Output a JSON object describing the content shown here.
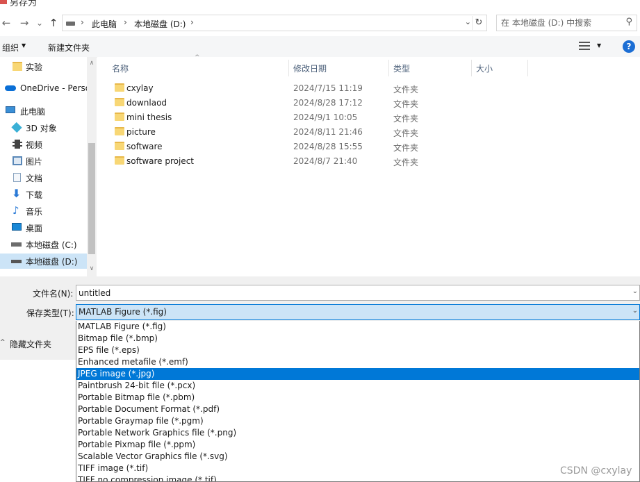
{
  "window": {
    "title": "另存为"
  },
  "nav": {
    "back_glyph": "←",
    "forward_glyph": "→",
    "recent_glyph": "⌄",
    "up_glyph": "↑",
    "breadcrumb": [
      "此电脑",
      "本地磁盘 (D:)"
    ],
    "breadcrumb_sep": "›",
    "dropdown_glyph": "⌄",
    "refresh_glyph": "↻",
    "search_placeholder": "在 本地磁盘 (D:) 中搜索",
    "search_icon_glyph": "⚲"
  },
  "toolbar": {
    "organize_label": "组织",
    "organize_caret": "▼",
    "new_folder_label": "新建文件夹",
    "view_caret": "▼",
    "help_glyph": "?"
  },
  "sidebar": {
    "up_arrow": "∧",
    "down_arrow": "∨",
    "items": [
      {
        "label": "实验",
        "icon": "folder-icon",
        "color": "#f8d775"
      },
      {
        "label": "OneDrive - Personal",
        "icon": "cloud-icon",
        "color": "#0a6fd6"
      },
      {
        "label": "此电脑",
        "icon": "computer-icon",
        "color": "#3a8fd6"
      },
      {
        "label": "3D 对象",
        "icon": "cube-icon",
        "color": "#3ab0d6"
      },
      {
        "label": "视频",
        "icon": "video-icon",
        "color": "#444444"
      },
      {
        "label": "图片",
        "icon": "picture-icon",
        "color": "#5a88b8"
      },
      {
        "label": "文档",
        "icon": "document-icon",
        "color": "#8aa4c0"
      },
      {
        "label": "下载",
        "icon": "download-icon",
        "color": "#2a7ad6"
      },
      {
        "label": "音乐",
        "icon": "music-icon",
        "color": "#2a7ad6"
      },
      {
        "label": "桌面",
        "icon": "desktop-icon",
        "color": "#1a88d6"
      },
      {
        "label": "本地磁盘 (C:)",
        "icon": "windows-drive-icon",
        "color": "#555555"
      },
      {
        "label": "本地磁盘 (D:)",
        "icon": "drive-icon",
        "color": "#555555",
        "selected": true
      }
    ]
  },
  "columns": {
    "name": "名称",
    "modified": "修改日期",
    "type": "类型",
    "size": "大小",
    "sort_glyph": "^"
  },
  "files": [
    {
      "name": "cxylay",
      "modified": "2024/7/15 11:19",
      "type": "文件夹"
    },
    {
      "name": "downlaod",
      "modified": "2024/8/28 17:12",
      "type": "文件夹"
    },
    {
      "name": "mini thesis",
      "modified": "2024/9/1 10:05",
      "type": "文件夹"
    },
    {
      "name": "picture",
      "modified": "2024/8/11 21:46",
      "type": "文件夹"
    },
    {
      "name": "software",
      "modified": "2024/8/28 15:55",
      "type": "文件夹"
    },
    {
      "name": "software project",
      "modified": "2024/8/7 21:40",
      "type": "文件夹"
    }
  ],
  "form": {
    "filename_label": "文件名(N):",
    "filename_value": "untitled",
    "filetype_label": "保存类型(T):",
    "filetype_value": "MATLAB Figure (*.fig)",
    "dropdown_glyph": "⌄",
    "hide_folders_label": "隐藏文件夹",
    "hide_folders_caret": "^"
  },
  "type_options": [
    {
      "label": "MATLAB Figure (*.fig)"
    },
    {
      "label": "Bitmap file (*.bmp)"
    },
    {
      "label": "EPS file (*.eps)"
    },
    {
      "label": "Enhanced metafile (*.emf)"
    },
    {
      "label": "JPEG image (*.jpg)",
      "selected": true
    },
    {
      "label": "Paintbrush 24-bit file (*.pcx)"
    },
    {
      "label": "Portable Bitmap file (*.pbm)"
    },
    {
      "label": "Portable Document Format (*.pdf)"
    },
    {
      "label": "Portable Graymap file (*.pgm)"
    },
    {
      "label": "Portable Network Graphics file (*.png)"
    },
    {
      "label": "Portable Pixmap file (*.ppm)"
    },
    {
      "label": "Scalable Vector Graphics file (*.svg)"
    },
    {
      "label": "TIFF image (*.tif)"
    },
    {
      "label": "TIFF no compression image (*.tif)"
    }
  ],
  "watermark": "CSDN @cxylay",
  "colors": {
    "accent": "#0078d7",
    "selection": "#cce4f7",
    "folder": "#f8d775"
  }
}
